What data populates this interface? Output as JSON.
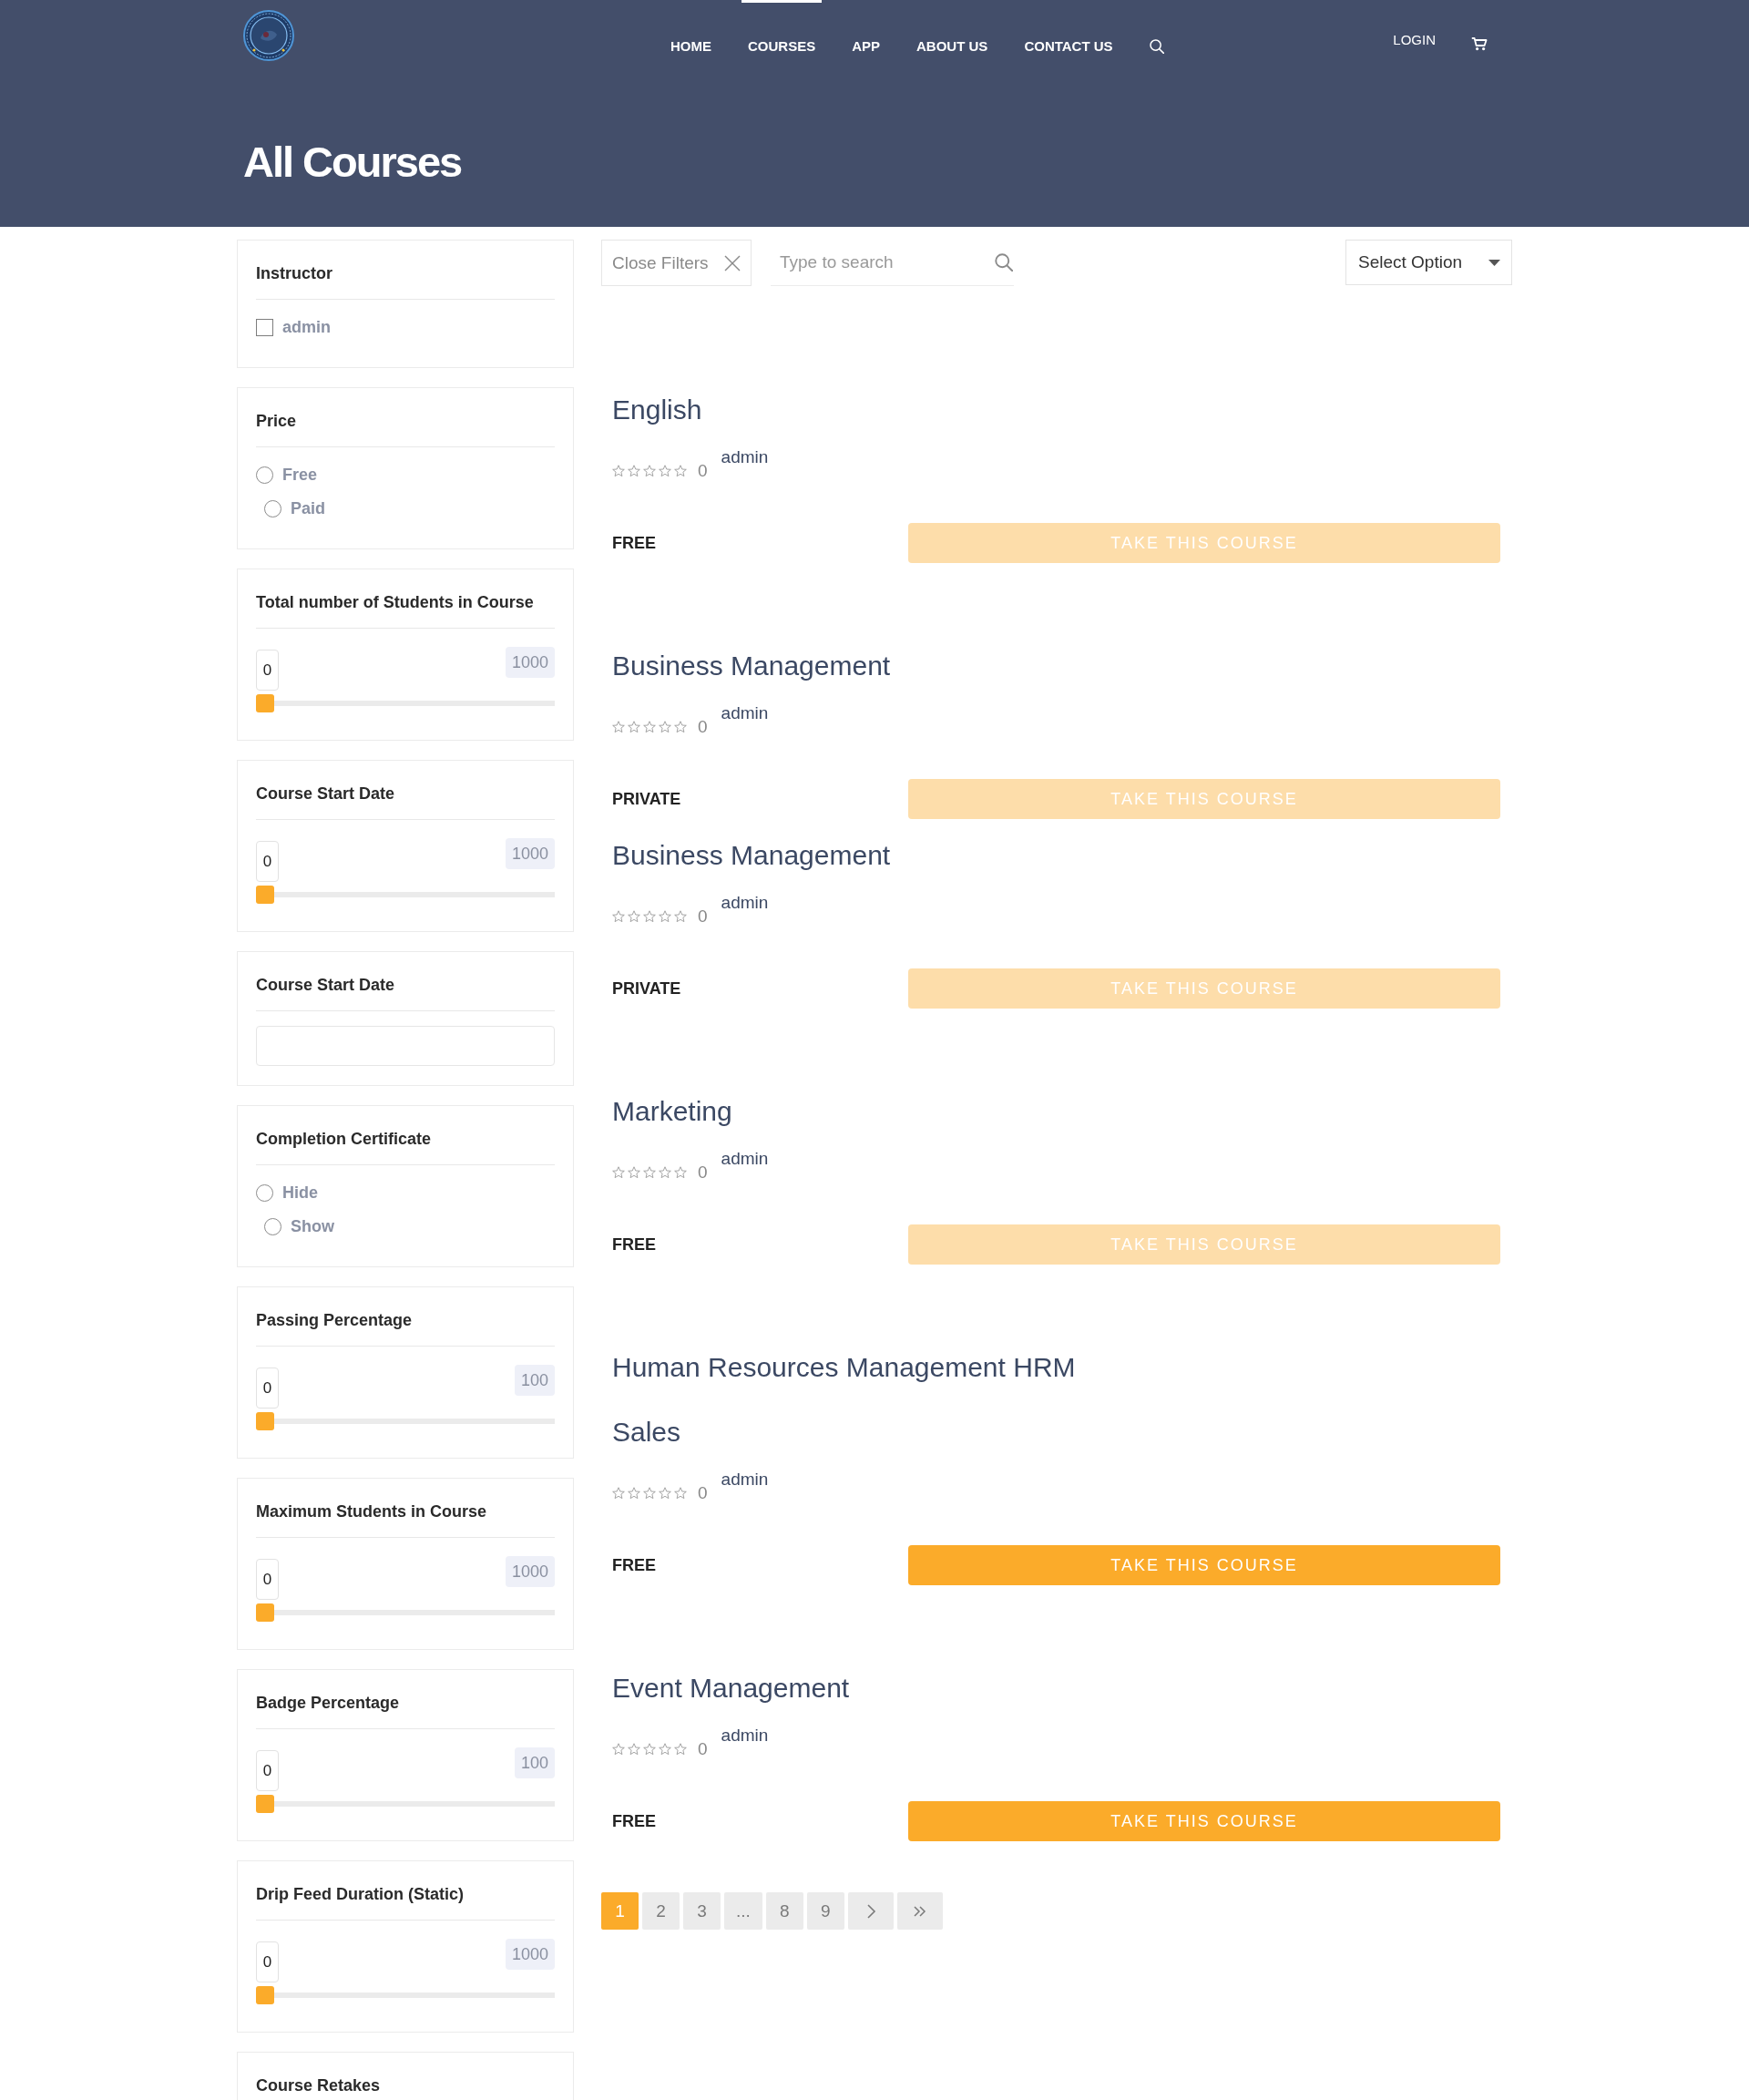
{
  "header": {
    "nav": [
      {
        "label": "HOME",
        "selected": false
      },
      {
        "label": "COURSES",
        "selected": true
      },
      {
        "label": "APP",
        "selected": false
      },
      {
        "label": "ABOUT US",
        "selected": false
      },
      {
        "label": "CONTACT US",
        "selected": false
      }
    ],
    "login": "LOGIN",
    "title": "All Courses"
  },
  "filters": [
    {
      "kind": "checks",
      "title": "Instructor",
      "options": [
        {
          "label": "admin",
          "checked": false
        }
      ]
    },
    {
      "kind": "radios",
      "title": "Price",
      "options": [
        {
          "label": "Free",
          "selected": false
        },
        {
          "label": "Paid",
          "selected": false
        }
      ]
    },
    {
      "kind": "range",
      "title": "Total number of Students in Course",
      "value": "0",
      "max": "1000",
      "level": 0
    },
    {
      "kind": "range",
      "title": "Course Start Date",
      "value": "0",
      "max": "1000",
      "level": 0
    },
    {
      "kind": "date",
      "title": "Course Start Date"
    },
    {
      "kind": "radios",
      "title": "Completion Certificate",
      "options": [
        {
          "label": "Hide",
          "selected": false
        },
        {
          "label": "Show",
          "selected": false
        }
      ]
    },
    {
      "kind": "range",
      "title": "Passing Percentage",
      "value": "0",
      "max": "100",
      "level": 0
    },
    {
      "kind": "range",
      "title": "Maximum Students in Course",
      "value": "0",
      "max": "1000",
      "level": 0
    },
    {
      "kind": "range",
      "title": "Badge Percentage",
      "value": "0",
      "max": "100",
      "level": 0
    },
    {
      "kind": "range",
      "title": "Drip Feed Duration (Static)",
      "value": "0",
      "max": "1000",
      "level": 0
    },
    {
      "kind": "heading",
      "title": "Course Retakes"
    }
  ],
  "toolbar": {
    "close_filters": "Close Filters",
    "search": {
      "placeholder": "Type to search"
    },
    "sort": {
      "value": "Select Option"
    }
  },
  "courses": [
    {
      "kind": "full",
      "title": "English",
      "stars": 0,
      "rating": "0",
      "instructor": "admin",
      "price": "FREE",
      "button": "TAKE THIS COURSE",
      "dimmed": true
    },
    {
      "kind": "cut",
      "title": "Business Management",
      "stars": 0,
      "rating": "0",
      "instructor": "admin",
      "price": "PRIVATE",
      "button": "TAKE THIS COURSE",
      "dimmed": true
    },
    {
      "kind": "full",
      "title": "Business Management",
      "stars": 0,
      "rating": "0",
      "instructor": "admin",
      "price": "PRIVATE",
      "button": "TAKE THIS COURSE",
      "dimmed": true
    },
    {
      "kind": "full",
      "title": "Marketing",
      "stars": 0,
      "rating": "0",
      "instructor": "admin",
      "price": "FREE",
      "button": "TAKE THIS COURSE",
      "dimmed": true
    },
    {
      "kind": "cut",
      "title": "Human Resources Management HRM"
    },
    {
      "kind": "full",
      "title": "Sales",
      "stars": 0,
      "rating": "0",
      "instructor": "admin",
      "price": "FREE",
      "button": "TAKE THIS COURSE",
      "dimmed": false
    },
    {
      "kind": "full",
      "title": "Event Management",
      "stars": 0,
      "rating": "0",
      "instructor": "admin",
      "price": "FREE",
      "button": "TAKE THIS COURSE",
      "dimmed": false
    }
  ],
  "pagination": [
    {
      "kind": "page",
      "label": "1",
      "selected": true
    },
    {
      "kind": "page",
      "label": "2",
      "selected": false
    },
    {
      "kind": "page",
      "label": "3",
      "selected": false
    },
    {
      "kind": "ellipsis",
      "label": "...",
      "selected": false
    },
    {
      "kind": "page",
      "label": "8",
      "selected": false
    },
    {
      "kind": "page",
      "label": "9",
      "selected": false
    },
    {
      "kind": "next",
      "selected": false
    },
    {
      "kind": "last",
      "selected": false
    }
  ]
}
